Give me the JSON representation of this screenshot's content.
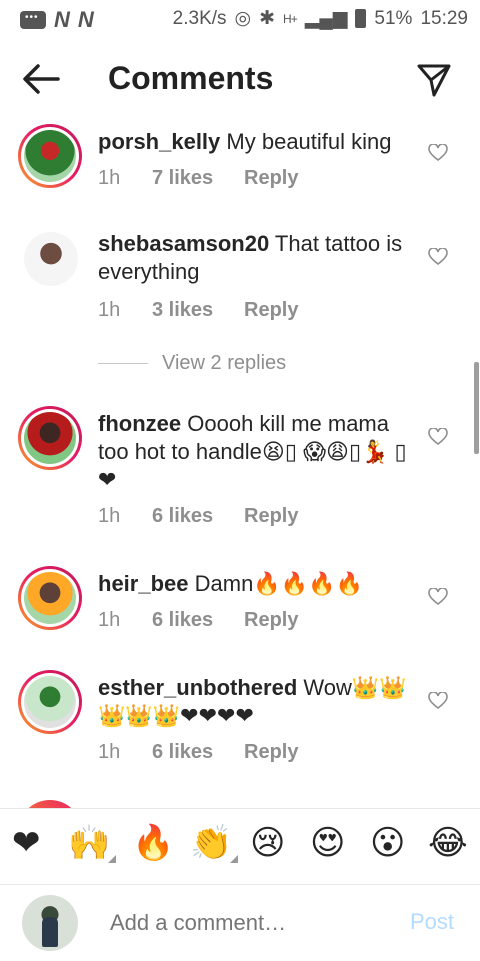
{
  "status_bar": {
    "speed": "2.3K/s",
    "signal": "H+",
    "battery": "51%",
    "time": "15:29"
  },
  "header": {
    "title": "Comments"
  },
  "comments": [
    {
      "username": "porsh_kelly",
      "text": "My beautiful king",
      "time": "1h",
      "likes": "7 likes",
      "reply": "Reply"
    },
    {
      "username": "shebasamson20",
      "text": "That tattoo is everything",
      "time": "1h",
      "likes": "3 likes",
      "reply": "Reply"
    },
    {
      "username": "fhonzee",
      "text": "Ooooh kill me mama too hot to handle😫▯ 😱😩▯💃 ▯❤",
      "time": "1h",
      "likes": "6 likes",
      "reply": "Reply"
    },
    {
      "username": "heir_bee",
      "text": "Damn🔥🔥🔥🔥",
      "time": "1h",
      "likes": "6 likes",
      "reply": "Reply"
    },
    {
      "username": "esther_unbothered",
      "text": "Wow👑👑👑👑👑❤❤❤❤",
      "time": "1h",
      "likes": "6 likes",
      "reply": "Reply"
    }
  ],
  "view_replies": "View 2 replies",
  "emoji_bar": [
    "❤",
    "🙌",
    "🔥",
    "👏",
    "😢",
    "😍",
    "😮",
    "😂"
  ],
  "add_comment": {
    "placeholder": "Add a comment…",
    "post_label": "Post"
  },
  "colors": {
    "accent_link": "#b3dbff",
    "muted": "#8e8e8e",
    "heart": "#e91e63"
  }
}
